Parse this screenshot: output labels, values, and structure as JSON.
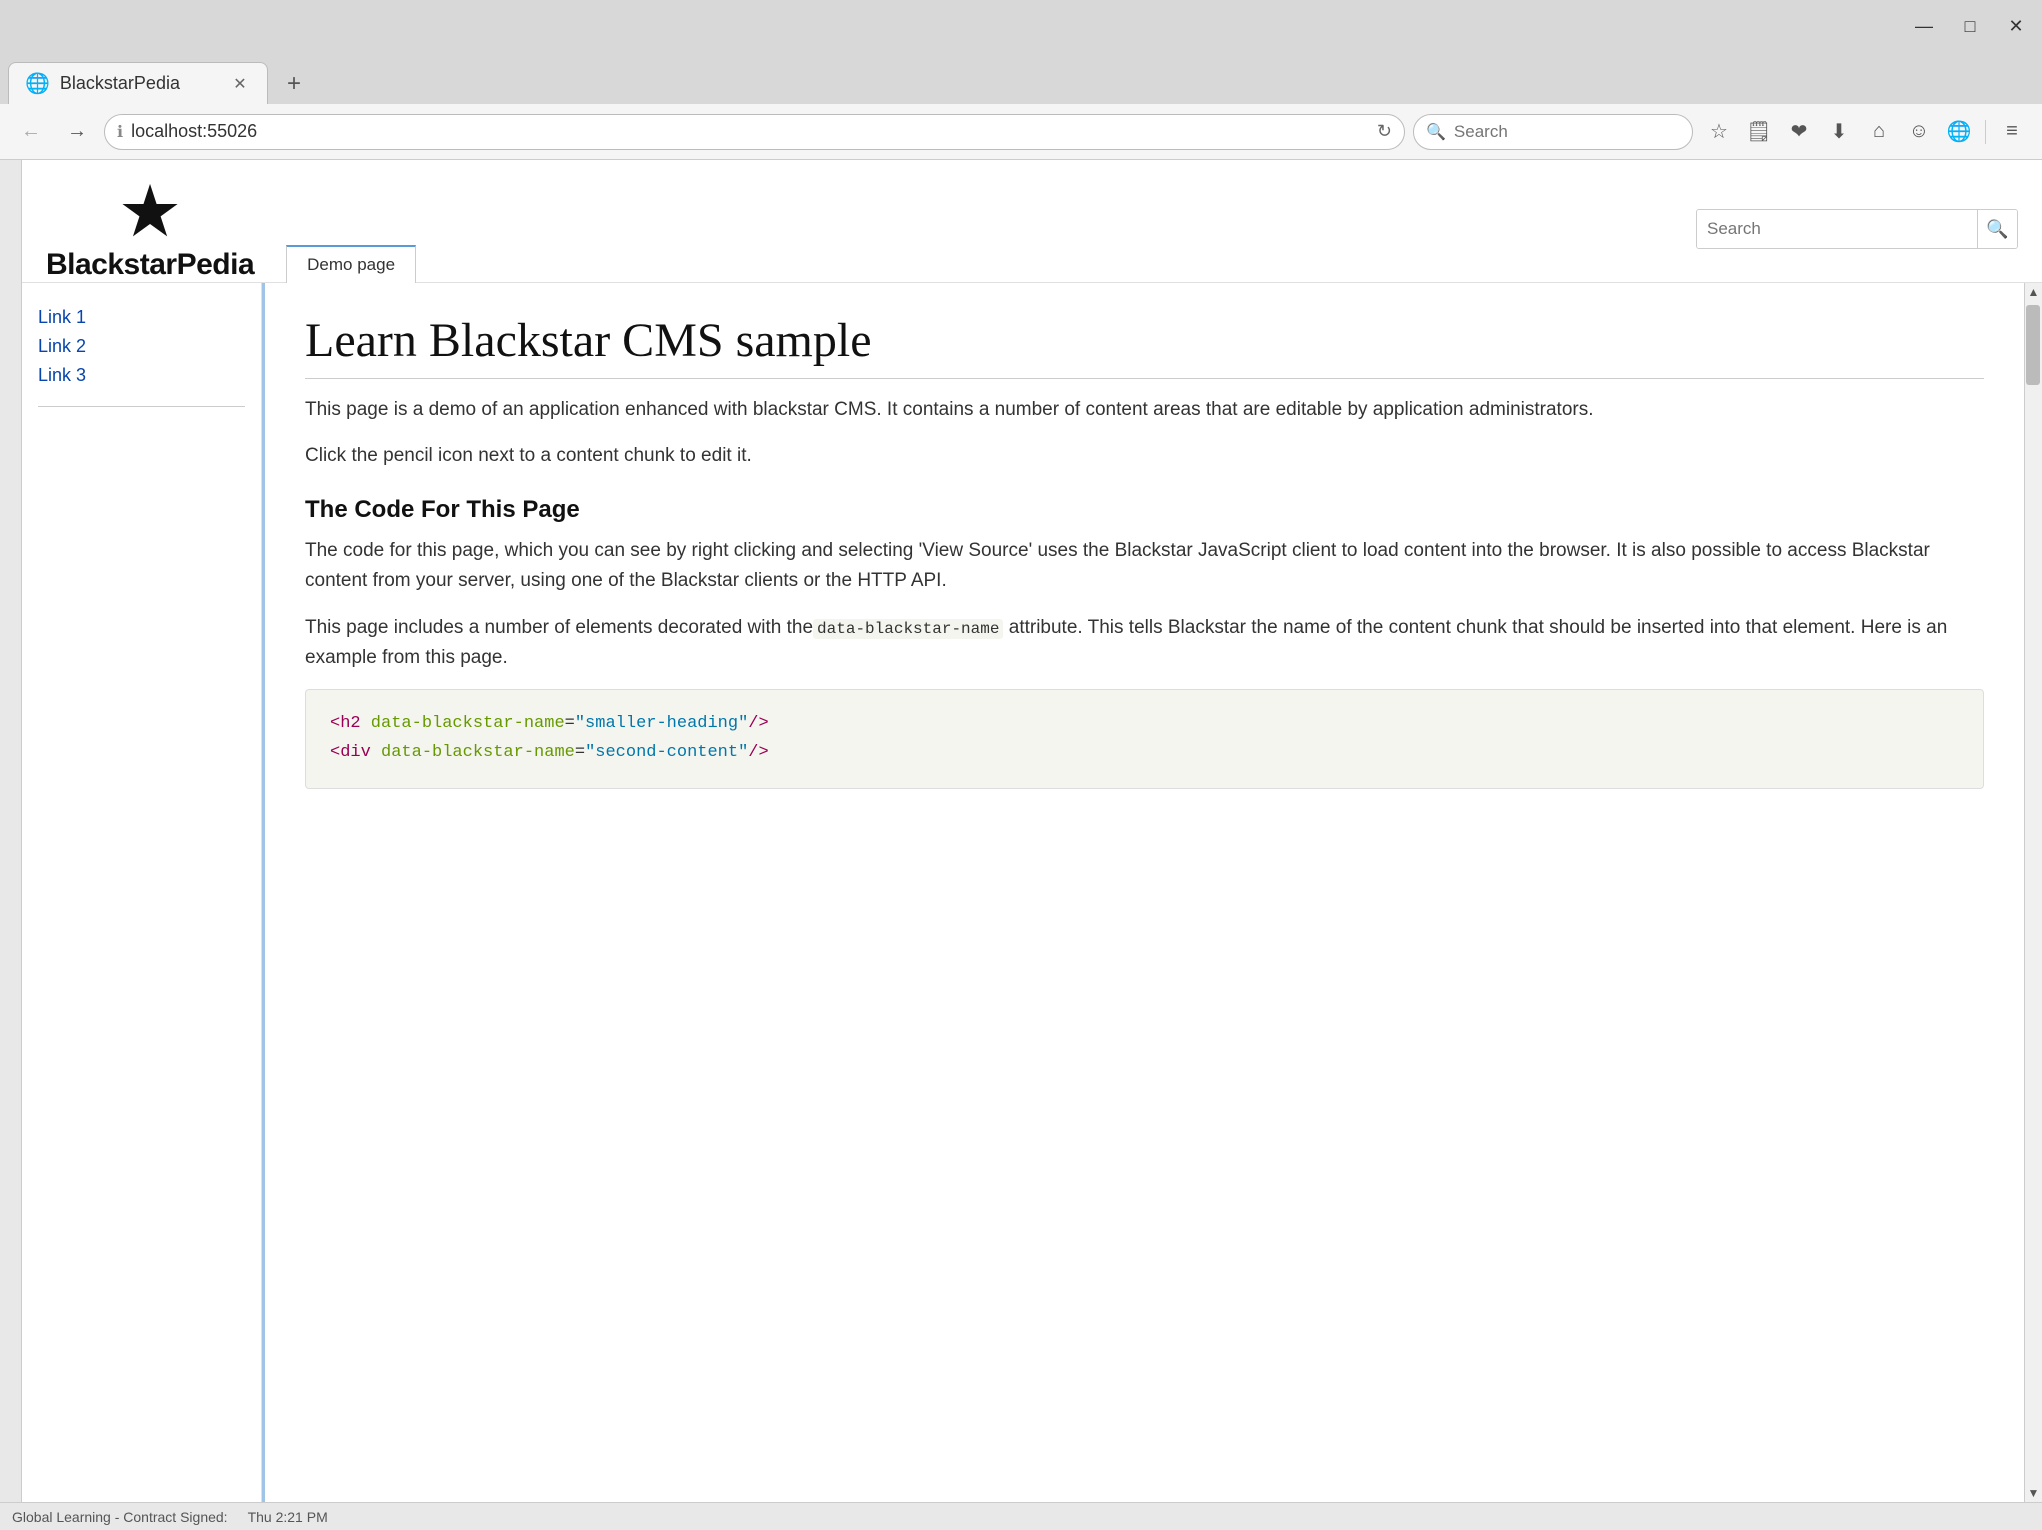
{
  "browser": {
    "title_bar": {
      "minimize": "—",
      "maximize": "□",
      "close": "✕"
    },
    "tab": {
      "label": "BlackstarPedia",
      "close": "✕"
    },
    "new_tab": "+",
    "address_bar": {
      "url": "localhost:55026",
      "info_icon": "ℹ",
      "refresh_icon": "↻"
    },
    "search_bar": {
      "placeholder": "Search"
    },
    "toolbar": {
      "star": "☆",
      "reading_list": "📋",
      "pocket": "▼",
      "download": "↓",
      "home": "⌂",
      "emoji": "☺",
      "extensions": "🌐",
      "menu": "≡"
    }
  },
  "wiki": {
    "brand": "BlackstarPedia",
    "nav_tabs": [
      {
        "label": "Demo page",
        "active": true
      }
    ],
    "search": {
      "placeholder": "Search",
      "button_icon": "🔍"
    },
    "sidebar": {
      "links": [
        {
          "label": "Link 1"
        },
        {
          "label": "Link 2"
        },
        {
          "label": "Link 3"
        }
      ]
    },
    "main": {
      "page_title": "Learn Blackstar CMS sample",
      "paragraphs": [
        "This page is a demo of an application enhanced with blackstar CMS. It contains a number of content areas that are editable by application administrators.",
        "Click the pencil icon next to a content chunk to edit it."
      ],
      "section_heading": "The Code For This Page",
      "section_paragraphs": [
        "The code for this page, which you can see by right clicking and selecting 'View Source' uses the Blackstar JavaScript client to load content into the browser. It is also possible to access Blackstar content from your server, using one of the Blackstar clients or the HTTP API.",
        "This page includes a number of elements decorated with the"
      ],
      "inline_code": "data-blackstar-name",
      "after_inline": " attribute. This tells Blackstar the name of the content chunk that should be inserted into that element. Here is an example from this page.",
      "code_block_lines": [
        {
          "tag": "<h2",
          "attr": " data-blackstar-name",
          "eq": "=",
          "val": "\"smaller-heading\"",
          "close": "/>"
        },
        {
          "tag": "<div",
          "attr": " data-blackstar-name",
          "eq": "=",
          "val": "\"second-content\"",
          "close": "/>"
        }
      ]
    }
  },
  "status_bar": {
    "left_text": "Global Learning - Contract Signed:",
    "right_text": "Thu 2:21 PM"
  }
}
